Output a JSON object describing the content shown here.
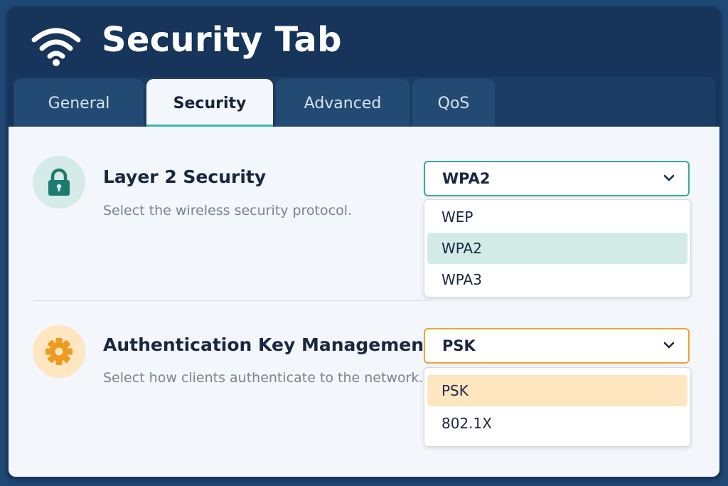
{
  "header": {
    "title": "Security Tab",
    "icon": "wifi-icon"
  },
  "tabs": [
    {
      "label": "General",
      "active": false
    },
    {
      "label": "Security",
      "active": true
    },
    {
      "label": "Advanced",
      "active": false
    },
    {
      "label": "QoS",
      "active": false
    }
  ],
  "layer2": {
    "icon": "lock-icon",
    "title": "Layer 2 Security",
    "description": "Select the wireless security protocol.",
    "selected": "WPA2",
    "options": [
      "WEP",
      "WPA2",
      "WPA3"
    ]
  },
  "akm": {
    "icon": "gear-icon",
    "title": "Authentication Key Management",
    "description": "Select how clients authenticate to the network.",
    "selected": "PSK",
    "options": [
      "PSK",
      "802.1X"
    ]
  },
  "colors": {
    "background": "#1f4a78",
    "window": "#17345a",
    "panel": "#f3f6fa",
    "teal_accent": "#3aa99b",
    "orange_accent": "#eba535",
    "teal_highlight": "#d2ebe6",
    "orange_highlight": "#fde6c0"
  }
}
